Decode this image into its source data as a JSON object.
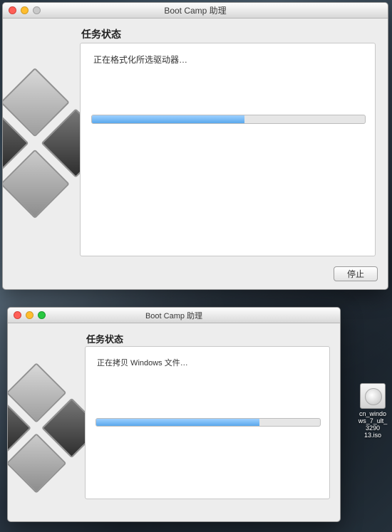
{
  "window1": {
    "title": "Boot Camp 助理",
    "heading": "任务状态",
    "status": "正在格式化所选驱动器…",
    "progress_percent": 56,
    "stop_button": "停止"
  },
  "window2": {
    "title": "Boot Camp 助理",
    "heading": "任务状态",
    "status": "正在拷贝 Windows 文件…",
    "progress_percent": 73
  },
  "desktop": {
    "iso_label": "cn_windows_7_ult_3290\n13.iso"
  }
}
